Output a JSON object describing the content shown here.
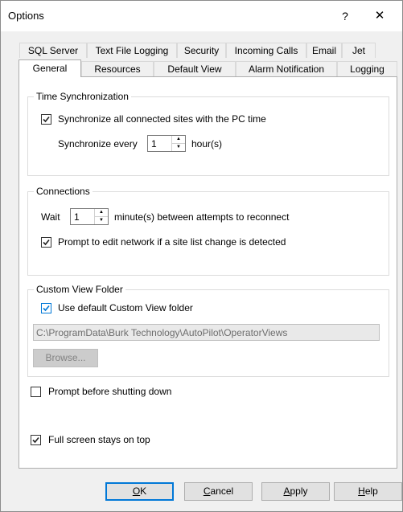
{
  "window": {
    "title": "Options",
    "help_glyph": "?",
    "close_glyph": "✕"
  },
  "tabs_back": [
    "SQL Server",
    "Text File Logging",
    "Security",
    "Incoming Calls",
    "Email",
    "Jet"
  ],
  "tabs_front": [
    "General",
    "Resources",
    "Default View",
    "Alarm Notification",
    "Logging"
  ],
  "selected_tab": "General",
  "time_sync": {
    "legend": "Time Synchronization",
    "sync_all_label": "Synchronize all connected sites with the PC time",
    "sync_all_checked": true,
    "sync_every_label": "Synchronize every",
    "sync_every_value": "1",
    "sync_every_unit": "hour(s)"
  },
  "connections": {
    "legend": "Connections",
    "wait_label": "Wait",
    "wait_value": "1",
    "wait_unit": "minute(s) between attempts to reconnect",
    "prompt_edit_label": "Prompt to edit network if a site list change is detected",
    "prompt_edit_checked": true
  },
  "custom_view": {
    "legend": "Custom View Folder",
    "use_default_label": "Use default Custom View folder",
    "use_default_checked": true,
    "path_value": "C:\\ProgramData\\Burk Technology\\AutoPilot\\OperatorViews",
    "browse_label": "Browse..."
  },
  "prompt_shutdown": {
    "label": "Prompt before shutting down",
    "checked": false
  },
  "fullscreen_top": {
    "label": "Full screen stays on top",
    "checked": true
  },
  "buttons": {
    "ok": "OK",
    "cancel": "Cancel",
    "apply": "Apply",
    "help": "Help"
  },
  "colors": {
    "accent": "#0078d7",
    "dialog_bg": "#f0f0f0",
    "panel_bg": "#ffffff"
  }
}
